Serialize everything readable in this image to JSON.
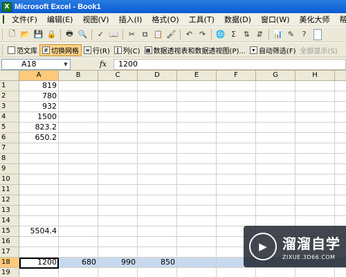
{
  "window": {
    "title": "Microsoft Excel - Book1"
  },
  "menu": [
    "文件(F)",
    "编辑(E)",
    "视图(V)",
    "插入(I)",
    "格式(O)",
    "工具(T)",
    "数据(D)",
    "窗口(W)",
    "美化大师",
    "帮助(H)"
  ],
  "toolbar2": {
    "items": [
      {
        "label": "范文库",
        "active": false,
        "disabled": false
      },
      {
        "label": "切换网格",
        "active": true,
        "disabled": false
      },
      {
        "label": "行(R)",
        "active": false,
        "disabled": false
      },
      {
        "label": "列(C)",
        "active": false,
        "disabled": false
      },
      {
        "label": "数据透视表和数据透视图(P)...",
        "active": false,
        "disabled": false
      },
      {
        "label": "自动筛选(F)",
        "active": false,
        "disabled": false
      },
      {
        "label": "全部显示(S)",
        "active": false,
        "disabled": true
      }
    ]
  },
  "formula_bar": {
    "name_box": "A18",
    "fx": "fx",
    "value": "1200"
  },
  "sheet": {
    "columns": [
      "A",
      "B",
      "C",
      "D",
      "E",
      "F",
      "G",
      "H"
    ],
    "selected_column": "A",
    "rows": [
      "1",
      "2",
      "3",
      "4",
      "5",
      "6",
      "7",
      "8",
      "9",
      "10",
      "11",
      "12",
      "13",
      "14",
      "15",
      "16",
      "17",
      "18",
      "19"
    ],
    "selected_row": "18",
    "cells": [
      {
        "ref": "A1",
        "row": 1,
        "col": 0,
        "value": "819"
      },
      {
        "ref": "A2",
        "row": 2,
        "col": 0,
        "value": "780"
      },
      {
        "ref": "A3",
        "row": 3,
        "col": 0,
        "value": "932"
      },
      {
        "ref": "A4",
        "row": 4,
        "col": 0,
        "value": "1500"
      },
      {
        "ref": "A5",
        "row": 5,
        "col": 0,
        "value": "823.2"
      },
      {
        "ref": "A6",
        "row": 6,
        "col": 0,
        "value": "650.2"
      },
      {
        "ref": "A15",
        "row": 15,
        "col": 0,
        "value": "5504.4"
      },
      {
        "ref": "A18",
        "row": 18,
        "col": 0,
        "value": "1200"
      },
      {
        "ref": "B18",
        "row": 18,
        "col": 1,
        "value": "680"
      },
      {
        "ref": "C18",
        "row": 18,
        "col": 2,
        "value": "990"
      },
      {
        "ref": "D18",
        "row": 18,
        "col": 3,
        "value": "850"
      }
    ]
  },
  "watermark": {
    "brand": "溜溜自学",
    "url": "ZIXUE.3D66.COM"
  },
  "colors": {
    "title_bar": "#0a5bd1",
    "selection_header": "#ffc97a",
    "selection_row": "#c7d9ee"
  }
}
